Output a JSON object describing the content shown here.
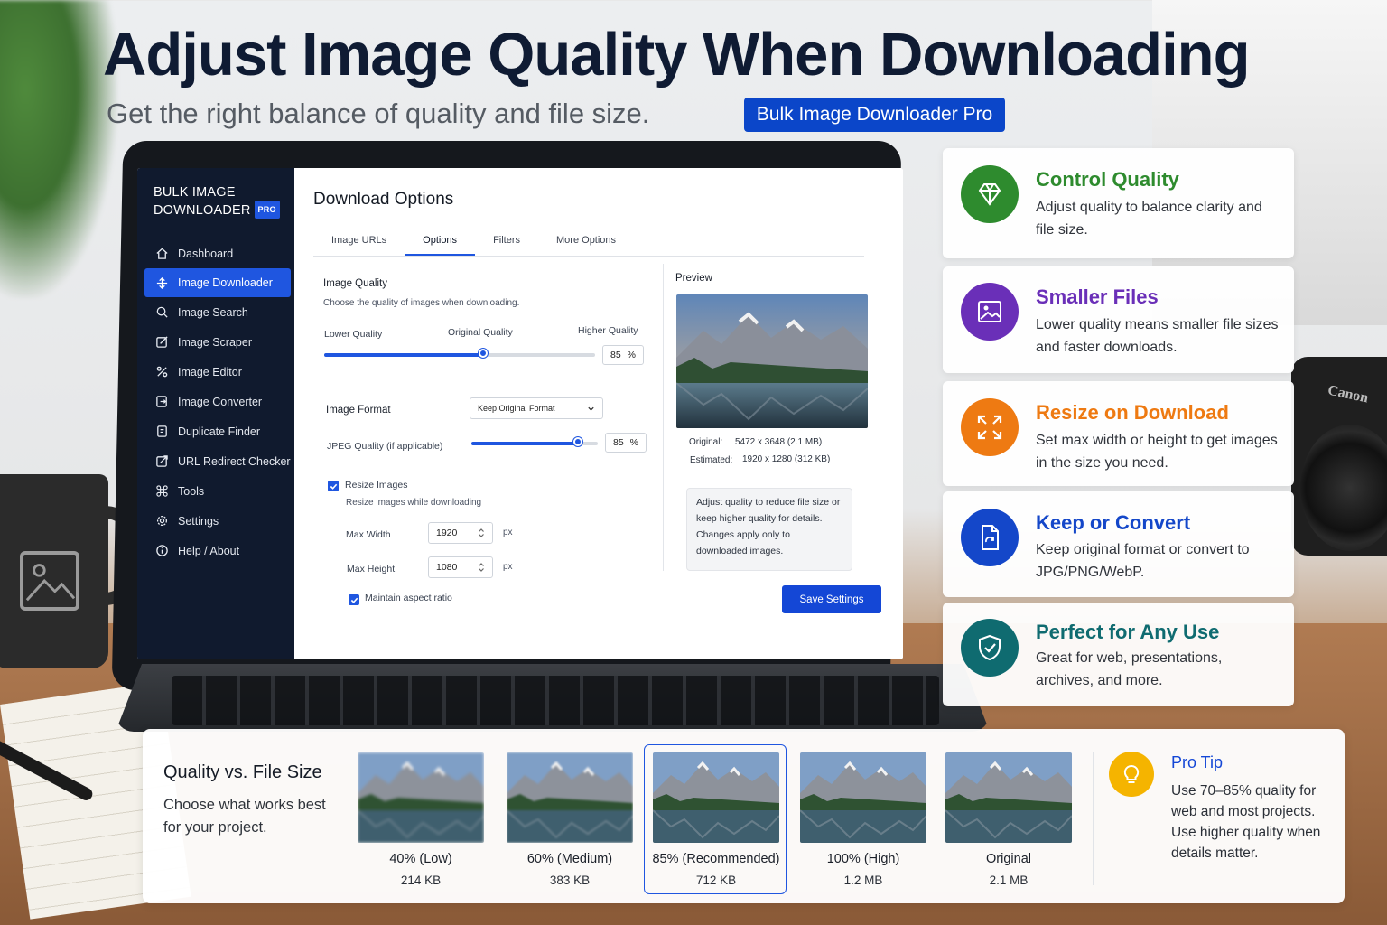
{
  "headline": "Adjust Image Quality When Downloading",
  "subhead": "Get the right balance of quality and file size.",
  "brand_pill": "Bulk Image Downloader Pro",
  "app": {
    "logo_line1": "BULK IMAGE",
    "logo_line2": "DOWNLOADER",
    "logo_badge": "PRO",
    "nav": [
      {
        "label": "Dashboard",
        "icon": "home-icon"
      },
      {
        "label": "Image Downloader",
        "icon": "download-icon",
        "active": true
      },
      {
        "label": "Image Search",
        "icon": "search-icon"
      },
      {
        "label": "Image Scraper",
        "icon": "scraper-icon"
      },
      {
        "label": "Image Editor",
        "icon": "editor-icon"
      },
      {
        "label": "Image Converter",
        "icon": "converter-icon"
      },
      {
        "label": "Duplicate Finder",
        "icon": "duplicate-icon"
      },
      {
        "label": "URL Redirect Checker",
        "icon": "redirect-icon"
      },
      {
        "label": "Tools",
        "icon": "command-icon"
      },
      {
        "label": "Settings",
        "icon": "gear-icon"
      },
      {
        "label": "Help / About",
        "icon": "info-icon"
      }
    ],
    "page_title": "Download Options",
    "tabs": [
      "Image URLs",
      "Options",
      "Filters",
      "More Options"
    ],
    "active_tab": "Options",
    "quality": {
      "label": "Image Quality",
      "hint": "Choose the quality of images when downloading.",
      "low_label": "Lower Quality",
      "mid_label": "Original Quality",
      "high_label": "Higher Quality",
      "value": "85",
      "unit": "%",
      "slider_fraction": 0.59
    },
    "format": {
      "label": "Image Format",
      "selected": "Keep Original Format"
    },
    "jpeg": {
      "label": "JPEG Quality (if applicable)",
      "value": "85",
      "unit": "%",
      "slider_fraction": 0.85
    },
    "resize": {
      "label": "Resize Images",
      "hint": "Resize images while downloading",
      "width_label": "Max Width",
      "width_value": "1920",
      "height_label": "Max Height",
      "height_value": "1080",
      "unit": "px",
      "aspect_label": "Maintain aspect ratio"
    },
    "preview": {
      "title": "Preview",
      "original_label": "Original:",
      "original_value": "5472 x 3648 (2.1 MB)",
      "estimated_label": "Estimated:",
      "estimated_value": "1920 x 1280 (312 KB)",
      "note": "Adjust quality to reduce file size or keep higher quality for details. Changes apply only to downloaded images."
    },
    "save_label": "Save Settings"
  },
  "features": [
    {
      "title": "Control Quality",
      "desc": "Adjust quality to balance clarity and file size.",
      "color": "#2e8b2e",
      "icon": "diamond-icon"
    },
    {
      "title": "Smaller Files",
      "desc": "Lower quality means smaller file sizes and faster downloads.",
      "color": "#6a2fb8",
      "icon": "image-icon"
    },
    {
      "title": "Resize on Download",
      "desc": "Set max width or height to get images in the size you need.",
      "color": "#ee7a12",
      "icon": "expand-icon"
    },
    {
      "title": "Keep or Convert",
      "desc": "Keep original format or convert to JPG/PNG/WebP.",
      "color": "#1447c9",
      "icon": "file-convert-icon"
    },
    {
      "title": "Perfect for Any Use",
      "desc": "Great for web, presentations, archives, and more.",
      "color": "#0f6b70",
      "icon": "shield-check-icon"
    }
  ],
  "comparison": {
    "title": "Quality vs. File Size",
    "desc": "Choose what works best for your project.",
    "samples": [
      {
        "name": "40% (Low)",
        "size": "214 KB"
      },
      {
        "name": "60% (Medium)",
        "size": "383 KB"
      },
      {
        "name": "85% (Recommended)",
        "size": "712 KB",
        "recommended": true
      },
      {
        "name": "100% (High)",
        "size": "1.2 MB"
      },
      {
        "name": "Original",
        "size": "2.1 MB"
      }
    ],
    "tip_title": "Pro Tip",
    "tip_desc": "Use 70–85% quality for web and most projects. Use higher quality when details matter."
  },
  "camera_brand": "Canon"
}
